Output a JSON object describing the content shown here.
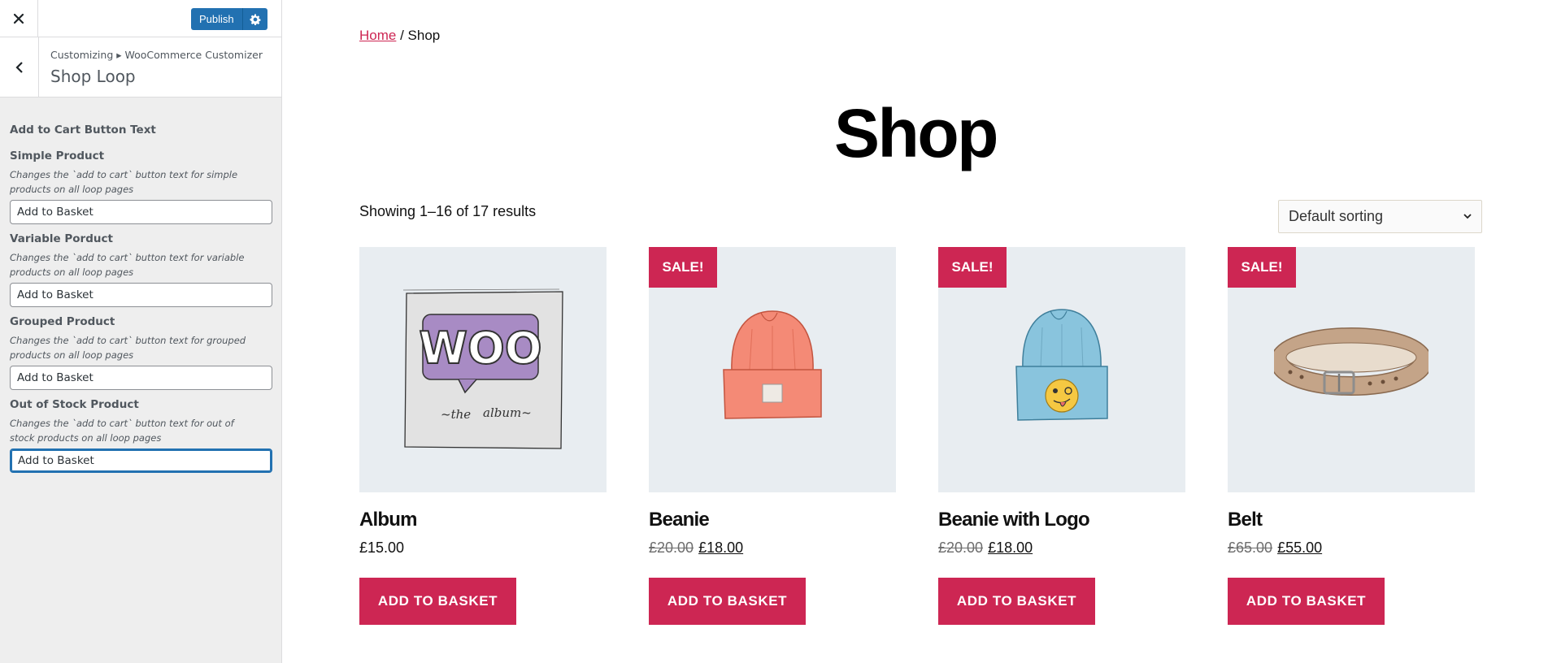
{
  "sidebar": {
    "close_label": "Close",
    "publish_label": "Publish",
    "breadcrumb": "Customizing ▸ WooCommerce Customizer",
    "section_title": "Shop Loop",
    "group_title": "Add to Cart Button Text",
    "controls": [
      {
        "label": "Simple Product",
        "description": "Changes the `add to cart` button text for simple products on all loop pages",
        "value": "Add to Basket"
      },
      {
        "label": "Variable Porduct",
        "description": "Changes the `add to cart` button text for variable products on all loop pages",
        "value": "Add to Basket"
      },
      {
        "label": "Grouped Product",
        "description": "Changes the `add to cart` button text for grouped products on all loop pages",
        "value": "Add to Basket"
      },
      {
        "label": "Out of Stock Product",
        "description": "Changes the `add to cart` button text for out of stock products on all loop pages",
        "value": "Add to Basket"
      }
    ]
  },
  "preview": {
    "breadcrumb": {
      "home": "Home",
      "separator": " / ",
      "current": "Shop"
    },
    "page_title": "Shop",
    "result_count": "Showing 1–16 of 17 results",
    "sorting": {
      "selected": "Default sorting"
    },
    "products": [
      {
        "name": "Album",
        "price": "£15.00",
        "old_price": "",
        "sale": false,
        "sale_label": "",
        "image": "woo-album-icon",
        "button": "ADD TO BASKET"
      },
      {
        "name": "Beanie",
        "price": "£18.00",
        "old_price": "£20.00",
        "sale": true,
        "sale_label": "SALE!",
        "image": "orange-beanie-icon",
        "button": "ADD TO BASKET"
      },
      {
        "name": "Beanie with Logo",
        "price": "£18.00",
        "old_price": "£20.00",
        "sale": true,
        "sale_label": "SALE!",
        "image": "blue-beanie-icon",
        "button": "ADD TO BASKET"
      },
      {
        "name": "Belt",
        "price": "£55.00",
        "old_price": "£65.00",
        "sale": true,
        "sale_label": "SALE!",
        "image": "belt-icon",
        "button": "ADD TO BASKET"
      }
    ]
  },
  "colors": {
    "accent": "#cd2653",
    "admin_blue": "#2271b1",
    "thumb_bg": "#e8edf1"
  }
}
